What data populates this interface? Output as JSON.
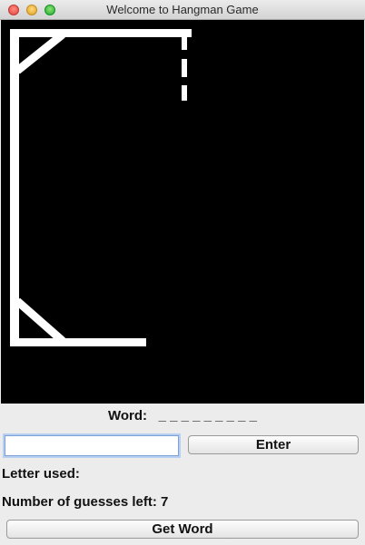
{
  "window": {
    "title": "Welcome to Hangman Game"
  },
  "game": {
    "word_label": "Word:",
    "word_display": "_ _ _ _ _ _ _ _ _",
    "input_value": "",
    "enter_label": "Enter",
    "letters_used_label": "Letter used:",
    "letters_used_value": "",
    "guesses_left_label": "Number of guesses left:",
    "guesses_left_value": "7",
    "get_word_label": "Get Word"
  },
  "colors": {
    "canvas_background": "#000000",
    "gallows": "#ffffff"
  }
}
